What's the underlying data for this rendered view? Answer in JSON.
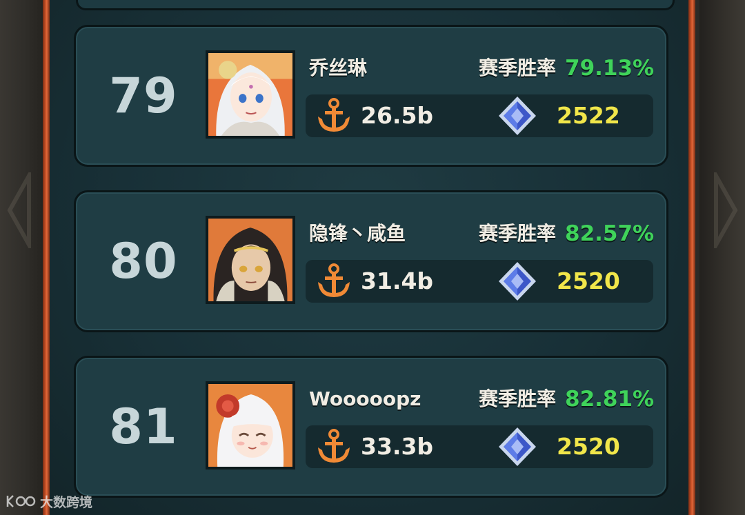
{
  "season_winrate_label": "赛季胜率",
  "entries": [
    {
      "rank": "79",
      "name": "乔丝琳",
      "winrate": "79.13%",
      "power": "26.5b",
      "score": "2522"
    },
    {
      "rank": "80",
      "name": "隐锋丶咸鱼",
      "winrate": "82.57%",
      "power": "31.4b",
      "score": "2520"
    },
    {
      "rank": "81",
      "name": "Wooooopz",
      "winrate": "82.81%",
      "power": "33.3b",
      "score": "2520"
    }
  ],
  "watermark": "大数跨境",
  "icons": {
    "power": "anchor-icon",
    "score": "crystal-icon"
  },
  "colors": {
    "winrate": "#3fd35a",
    "score": "#f1e64a",
    "frame": "#d2562a",
    "card": "#1f3d44"
  }
}
